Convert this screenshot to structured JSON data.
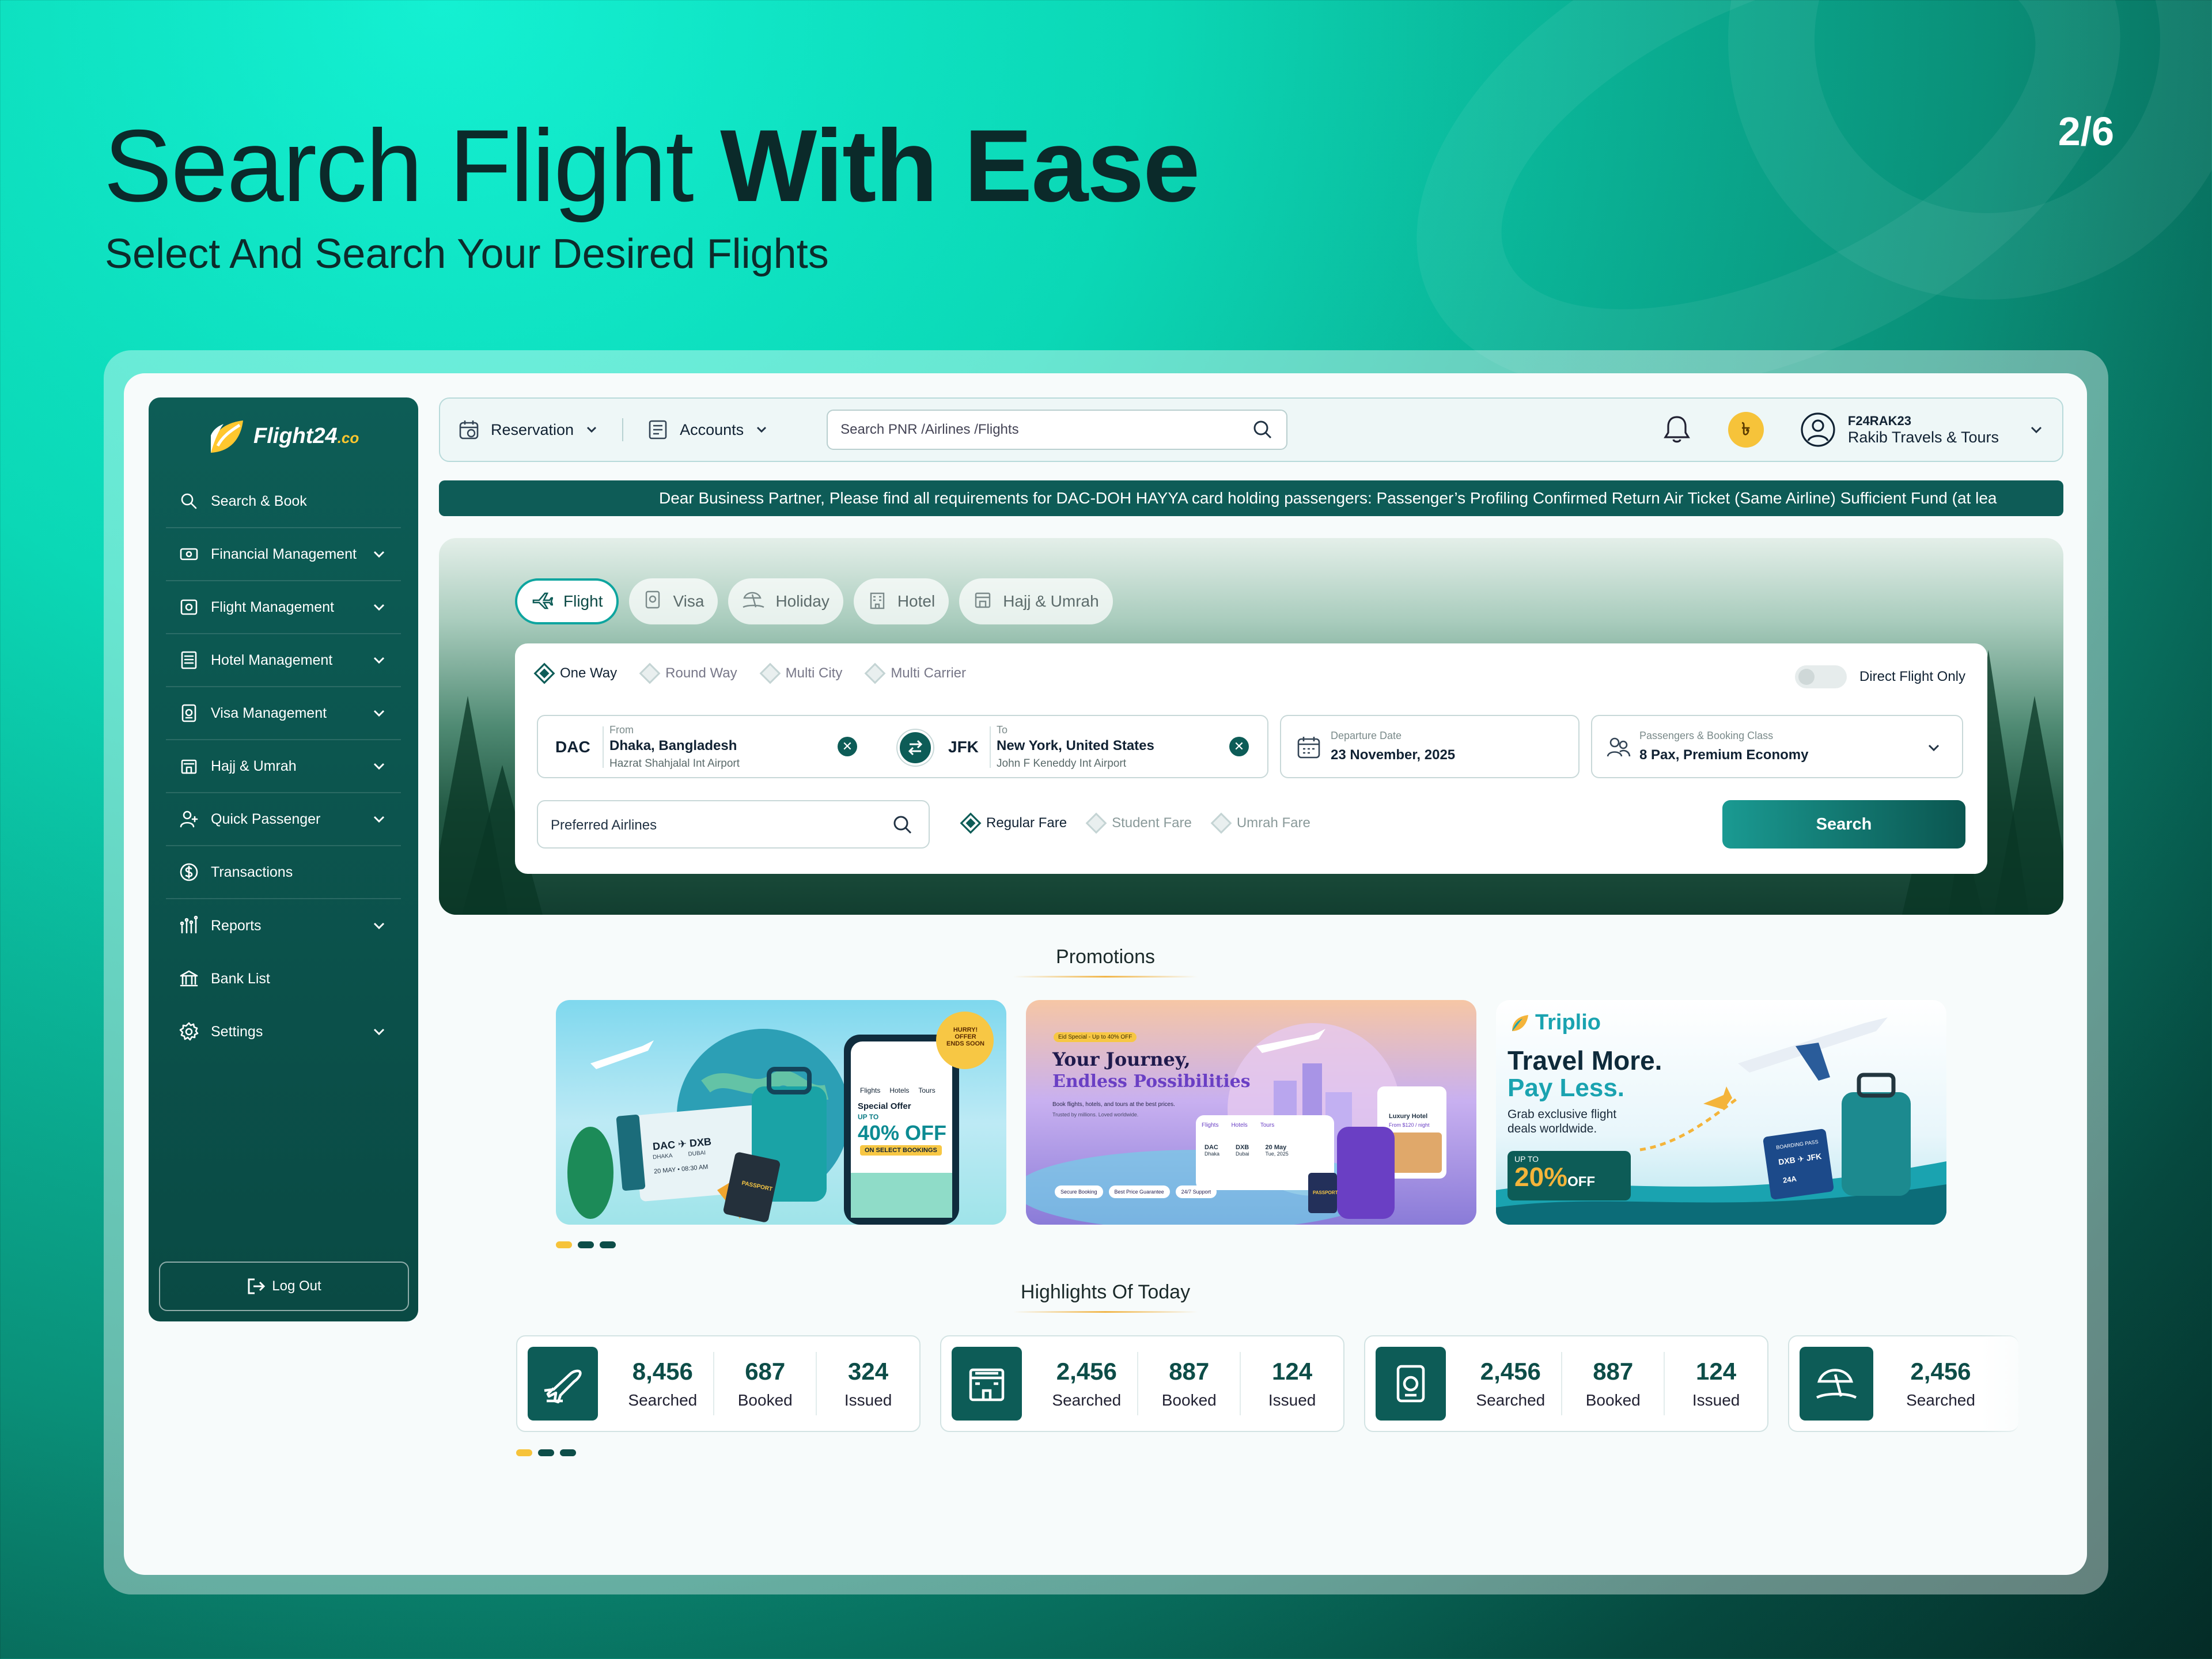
{
  "slide": {
    "title_light": "Search Flight",
    "title_bold": "With Ease",
    "subtitle": "Select And Search Your Desired Flights",
    "pager": "2/6"
  },
  "brand": {
    "name": "Flight24",
    "suffix": ".co",
    "accent": "#0d5c57",
    "highlight": "#f6c33a"
  },
  "sidebar": {
    "items": [
      {
        "label": "Search & Book",
        "icon": "search-icon",
        "expandable": false
      },
      {
        "label": "Financial Management",
        "icon": "money-icon",
        "expandable": true
      },
      {
        "label": "Flight Management",
        "icon": "camera-box-icon",
        "expandable": true
      },
      {
        "label": "Hotel Management",
        "icon": "list-icon",
        "expandable": true
      },
      {
        "label": "Visa Management",
        "icon": "passport-icon",
        "expandable": true
      },
      {
        "label": "Hajj & Umrah",
        "icon": "mosque-icon",
        "expandable": true
      },
      {
        "label": "Quick Passenger",
        "icon": "user-add-icon",
        "expandable": true
      },
      {
        "label": "Transactions",
        "icon": "dollar-circle-icon",
        "expandable": false
      },
      {
        "label": "Reports",
        "icon": "chart-icon",
        "expandable": true
      },
      {
        "label": "Bank List",
        "icon": "bank-icon",
        "expandable": false
      },
      {
        "label": "Settings",
        "icon": "gear-icon",
        "expandable": true
      }
    ],
    "logout": "Log Out"
  },
  "topbar": {
    "reservation": "Reservation",
    "accounts": "Accounts",
    "search_placeholder": "Search PNR /Airlines /Flights",
    "coin_symbol": "৳",
    "user_id": "F24RAK23",
    "user_name": "Rakib Travels & Tours"
  },
  "ticker": "Dear Business Partner, Please find all requirements for DAC-DOH HAYYA card holding passengers: Passenger’s Profiling Confirmed Return Air Ticket (Same Airline) Sufficient Fund (at lea",
  "search": {
    "tabs": [
      {
        "label": "Flight",
        "icon": "plane-icon",
        "active": true
      },
      {
        "label": "Visa",
        "icon": "passport-icon",
        "active": false
      },
      {
        "label": "Holiday",
        "icon": "beach-icon",
        "active": false
      },
      {
        "label": "Hotel",
        "icon": "building-icon",
        "active": false
      },
      {
        "label": "Hajj & Umrah",
        "icon": "mosque-icon",
        "active": false
      }
    ],
    "trip_types": [
      {
        "label": "One Way",
        "selected": true
      },
      {
        "label": "Round Way",
        "selected": false
      },
      {
        "label": "Multi City",
        "selected": false
      },
      {
        "label": "Multi Carrier",
        "selected": false
      }
    ],
    "direct_flight_label": "Direct Flight Only",
    "from": {
      "code": "DAC",
      "label": "From",
      "city": "Dhaka, Bangladesh",
      "airport": "Hazrat Shahjalal Int Airport"
    },
    "to": {
      "code": "JFK",
      "label": "To",
      "city": "New York, United States",
      "airport": "John F Keneddy Int Airport"
    },
    "departure": {
      "label": "Departure Date",
      "value": "23 November, 2025"
    },
    "passengers": {
      "label": "Passengers & Booking Class",
      "value": "8 Pax, Premium Economy"
    },
    "airlines_placeholder": "Preferred Airlines",
    "fares": [
      {
        "label": "Regular Fare",
        "selected": true
      },
      {
        "label": "Student Fare",
        "selected": false
      },
      {
        "label": "Umrah Fare",
        "selected": false
      }
    ],
    "button": "Search"
  },
  "promotions": {
    "title": "Promotions",
    "cards": [
      {
        "route_from": "DAC",
        "route_to": "DXB",
        "from_city": "DHAKA",
        "to_city": "DUBAI",
        "date": "20 MAY • 08:30 AM",
        "passport": "PASSPORT",
        "badge": "HURRY! OFFER ENDS SOON",
        "offer_title": "Special Offer",
        "offer_prefix": "UP TO",
        "offer": "40% OFF",
        "offer_note": "ON SELECT BOOKINGS",
        "app_tabs": [
          "Flights",
          "Hotels",
          "Tours"
        ]
      },
      {
        "badge": "Eid Special - Up to 40% OFF",
        "title": "Your Journey,",
        "title2": "Endless Possibilities",
        "desc": "Book flights, hotels, and tours at the best prices.",
        "desc2": "Trusted by millions. Loved worldwide.",
        "hotel": "Luxury Hotel",
        "hotel_price": "From $120 / night",
        "app_tabs": [
          "Flights",
          "Hotels",
          "Tours"
        ],
        "from": "DAC",
        "from_city": "Dhaka",
        "to": "DXB",
        "to_city": "Dubai",
        "depart": "20 May",
        "depart_note": "Tue, 2025",
        "passport": "PASSPORT",
        "features": [
          "Secure Booking",
          "Best Price Guarantee",
          "24/7 Support"
        ]
      },
      {
        "brand": "Triplio",
        "title": "Travel More.",
        "title2": "Pay Less.",
        "desc": "Grab exclusive flight deals worldwide.",
        "offer_prefix": "UP TO",
        "offer": "20%",
        "offer_suffix": "OFF",
        "pass_title": "BOARDING PASS",
        "pass_from": "DXB",
        "pass_to": "JFK",
        "pass_seat": "24A"
      }
    ]
  },
  "highlights": {
    "title": "Highlights Of Today",
    "cards": [
      {
        "icon": "plane-icon",
        "stats": [
          {
            "n": "8,456",
            "l": "Searched"
          },
          {
            "n": "687",
            "l": "Booked"
          },
          {
            "n": "324",
            "l": "Issued"
          }
        ]
      },
      {
        "icon": "hotel-icon",
        "stats": [
          {
            "n": "2,456",
            "l": "Searched"
          },
          {
            "n": "887",
            "l": "Booked"
          },
          {
            "n": "124",
            "l": "Issued"
          }
        ]
      },
      {
        "icon": "passport-icon",
        "stats": [
          {
            "n": "2,456",
            "l": "Searched"
          },
          {
            "n": "887",
            "l": "Booked"
          },
          {
            "n": "124",
            "l": "Issued"
          }
        ]
      },
      {
        "icon": "beach-icon",
        "stats": [
          {
            "n": "2,456",
            "l": "Searched"
          }
        ]
      }
    ]
  }
}
